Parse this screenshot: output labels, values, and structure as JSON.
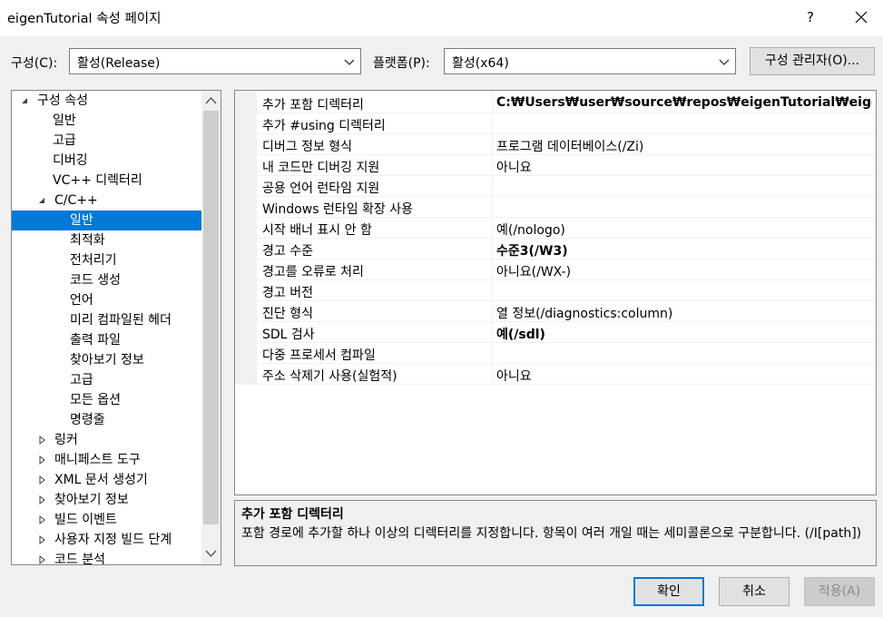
{
  "window": {
    "title": "eigenTutorial 속성 페이지",
    "help_label": "?"
  },
  "config": {
    "config_label": "구성(C):",
    "config_value": "활성(Release)",
    "platform_label": "플랫폼(P):",
    "platform_value": "활성(x64)",
    "manager_label": "구성 관리자(O)..."
  },
  "tree": {
    "items": [
      {
        "label": "구성 속성",
        "toggle": "expanded"
      },
      {
        "label": "일반"
      },
      {
        "label": "고급"
      },
      {
        "label": "디버깅"
      },
      {
        "label": "VC++ 디렉터리"
      },
      {
        "label": "C/C++",
        "toggle": "expanded"
      },
      {
        "label": "일반",
        "selected": true
      },
      {
        "label": "최적화"
      },
      {
        "label": "전처리기"
      },
      {
        "label": "코드 생성"
      },
      {
        "label": "언어"
      },
      {
        "label": "미리 컴파일된 헤더"
      },
      {
        "label": "출력 파일"
      },
      {
        "label": "찾아보기 정보"
      },
      {
        "label": "고급"
      },
      {
        "label": "모든 옵션"
      },
      {
        "label": "명령줄"
      },
      {
        "label": "링커",
        "toggle": "collapsed"
      },
      {
        "label": "매니페스트 도구",
        "toggle": "collapsed"
      },
      {
        "label": "XML 문서 생성기",
        "toggle": "collapsed"
      },
      {
        "label": "찾아보기 정보",
        "toggle": "collapsed"
      },
      {
        "label": "빌드 이벤트",
        "toggle": "collapsed"
      },
      {
        "label": "사용자 지정 빌드 단계",
        "toggle": "collapsed"
      },
      {
        "label": "코드 분석",
        "toggle": "collapsed"
      }
    ]
  },
  "grid": {
    "rows": [
      {
        "name": "추가 포함 디렉터리",
        "value": "C:₩Users₩user₩source₩repos₩eigenTutorial₩eigen",
        "bold": true
      },
      {
        "name": "추가 #using 디렉터리",
        "value": ""
      },
      {
        "name": "디버그 정보 형식",
        "value": "프로그램 데이터베이스(/Zi)"
      },
      {
        "name": "내 코드만 디버깅 지원",
        "value": "아니요"
      },
      {
        "name": "공용 언어 런타임 지원",
        "value": ""
      },
      {
        "name": "Windows 런타임 확장 사용",
        "value": ""
      },
      {
        "name": "시작 배너 표시 안 함",
        "value": "예(/nologo)"
      },
      {
        "name": "경고 수준",
        "value": "수준3(/W3)",
        "bold": true
      },
      {
        "name": "경고를 오류로 처리",
        "value": "아니요(/WX-)"
      },
      {
        "name": "경고 버전",
        "value": ""
      },
      {
        "name": "진단 형식",
        "value": "열 정보(/diagnostics:column)"
      },
      {
        "name": "SDL 검사",
        "value": "예(/sdl)",
        "bold": true
      },
      {
        "name": "다중 프로세서 컴파일",
        "value": ""
      },
      {
        "name": "주소 삭제기 사용(실험적)",
        "value": "아니요"
      }
    ]
  },
  "description": {
    "title": "추가 포함 디렉터리",
    "text": "포함 경로에 추가할 하나 이상의 디렉터리를 지정합니다. 항목이 여러 개일 때는 세미콜론으로 구분합니다.     (/I[path])"
  },
  "buttons": {
    "ok": "확인",
    "cancel": "취소",
    "apply": "적용(A)"
  },
  "icons": {
    "close": "close-icon",
    "dropdown": "chevron-down-icon",
    "expanded": "triangle-expanded-icon",
    "collapsed": "triangle-collapsed-icon",
    "scroll_up": "chevron-up-icon",
    "scroll_down": "chevron-down-icon"
  },
  "colors": {
    "selection": "#0078d7",
    "window_bg": "#f0f0f0",
    "panel_bg": "#ffffff"
  }
}
